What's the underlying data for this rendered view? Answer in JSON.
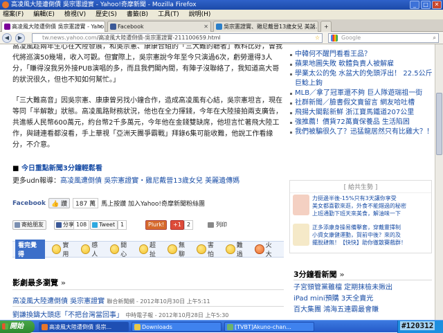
{
  "window": {
    "title": "高凌風大陸遭倒債 吳宗憲證實 - Yahoo!奇摩新聞 - Mozilla Firefox"
  },
  "menu": [
    "檔案(F)",
    "編輯(E)",
    "檢視(V)",
    "歷史(S)",
    "書籤(B)",
    "工具(T)",
    "說明(H)"
  ],
  "tabs": [
    {
      "label": "高凌風大陸遭倒債 吳宗憲證實 - Yaho...",
      "active": true
    },
    {
      "label": "Facebook",
      "active": false
    },
    {
      "label": "吳宗憲證實、雞尼戴晉13歲女兒 美話...",
      "active": false
    }
  ],
  "nav": {
    "url_host": "tw.news.yahoo.com",
    "url_path": "/高凌風大陸遭倒債-吳宗憲證實-211100659.html",
    "search_placeholder": "Google"
  },
  "article": {
    "para0": "高凌風趁兩年生心在大陸發展，和吳宗憲、康康合組的「三大難的聽者」教科比好，曾我代將巡演50幾場，收入可觀。但實際上，吳宗憲說今年至今只演過6次，虧勞還得3人分，「賺得沒我另外接PUB演唱的多，而且我們閣內間，有陣子沒聯絡了，我知道高大哥的狀況很久，但也不知如何幫忙。」",
    "para1": "「三大難高音」因吳宗憲、康康曾另找小鐘合作，造成高凌風有心結，吳宗憲坦言，現在等同「半解散」狀態。高凌風路財務狀況，他也在全力揮錢，今年在大陸接拍兩支廣告，共進帳人民幣600萬元，約台幣2千多萬元，今年他在金錢雙缺席，他坦言忙著飛大陸工作，與鏈連看都沒看，手上華視「亞洲天團爭霸戰」拜錄6集可能收難，他說工作看緣分，不介意。",
    "video_link": "今日重點新聞3分鐘輕鬆看",
    "more_label": "更多udn報導：",
    "more_links": "高凌風遭倒債 吳宗憲證實・雞尼戴晉13歲女兒 美麗遺傳媽",
    "fb_label": "Facebook",
    "fb_like": "讚",
    "fb_count": "187 萬",
    "fb_join": "馬上按讚 加入Yahoo!奇摩新聞粉絲團",
    "share": {
      "email": "寄給朋友",
      "fb": "分享",
      "fb_count": "108",
      "tweet": "Tweet",
      "tweet_count": "1",
      "plurk": "Plurk!",
      "gplus": "+1",
      "gplus_count": "2",
      "print": "列印"
    },
    "mood_label": "看完覺得",
    "moods": [
      "實用",
      "感人",
      "開心",
      "超扯",
      "無聊",
      "害怕",
      "難過",
      "火大"
    ],
    "popular_title": "影劇最多瀏覽",
    "popular": [
      {
        "title": "高凌風大陸遭倒債 吳宗憲證實",
        "meta": "聯合新聞網 - 2012年10月30日 上午5:11"
      },
      {
        "title": "劉謙換鑄大頭痣「不把台灣當回事」",
        "meta": "中時電子報 - 2012年10月28日 上午5:30"
      }
    ]
  },
  "sidebar": {
    "headlines": [
      "中韓何不醒門看看王品？",
      "蘋果地圖失敗 軟體負責人被解雇",
      "學業太公的兔 水盆大的免頭浮出！ 22.5公斤巨鯰上鉤",
      "MLB／拿了冠軍還不夠 巨人隊遊瑞祖一街",
      "社群新聞／臉書假文賣留言 網友哈吐槽",
      "飛揚大閣鬆新鮮 浙江寶馬鐵道207公里",
      "強推薦！價貨72萬賣保養品 生活陷困",
      "我們被騙很久了？迅猛龍居然只有比雞大？！"
    ],
    "sponsor_title": "[ 給共生勢 ]",
    "ads": [
      "力挺邊半後-15%只有3天讓你享受",
      "美女都喜歡來逛，外食不能錯過的秘密",
      "上班通勤下班天來美食，解油味一下",
      "正多添康身操易備擊套，穿戴靈擇制",
      "小資女康健運動，賀前中後？來的及",
      "擺脫肆無！【快快】助你徹散賽戲群！"
    ],
    "news3_title": "3分鐘看新聞",
    "news3": [
      "子宮頸管黨雖檔 定期抹檢未揪出",
      "iPad mini預購 3天全賣光",
      "百大集團 鴻海五連霸最會賺"
    ]
  },
  "taskbar": {
    "start": "開始",
    "tasks": [
      "高凌風大陸遭倒債 吳宗...",
      "Downloads",
      "[TVBT]Akuno-chan..."
    ]
  },
  "watermark": "#120312"
}
